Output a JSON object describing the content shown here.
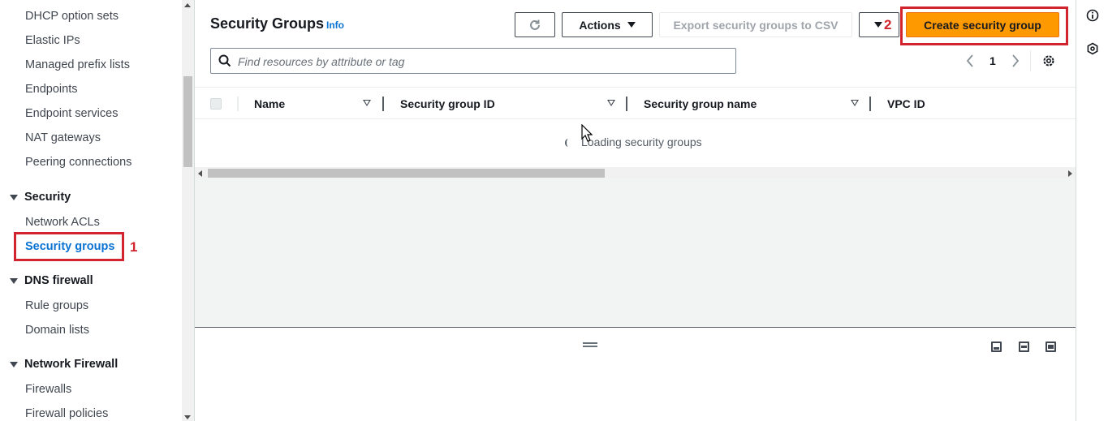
{
  "sidebar": {
    "items_top": [
      {
        "label": "DHCP option sets"
      },
      {
        "label": "Elastic IPs"
      },
      {
        "label": "Managed prefix lists"
      },
      {
        "label": "Endpoints"
      },
      {
        "label": "Endpoint services"
      },
      {
        "label": "NAT gateways"
      },
      {
        "label": "Peering connections"
      }
    ],
    "security": {
      "label": "Security",
      "items": [
        {
          "label": "Network ACLs"
        },
        {
          "label": "Security groups",
          "active": true
        }
      ]
    },
    "dns_firewall": {
      "label": "DNS firewall",
      "items": [
        {
          "label": "Rule groups"
        },
        {
          "label": "Domain lists"
        }
      ]
    },
    "network_firewall": {
      "label": "Network Firewall",
      "items": [
        {
          "label": "Firewalls"
        },
        {
          "label": "Firewall policies"
        }
      ]
    }
  },
  "annotations": {
    "step1": "1",
    "step2": "2",
    "color": "#d1242f"
  },
  "header": {
    "title": "Security Groups",
    "info": "Info",
    "refresh_icon": "refresh-icon",
    "actions_label": "Actions",
    "export_label": "Export security groups to CSV",
    "create_label": "Create security group",
    "primary_color": "#ff9900"
  },
  "search": {
    "placeholder": "Find resources by attribute or tag"
  },
  "pagination": {
    "current_page": "1"
  },
  "table": {
    "columns": [
      "Name",
      "Security group ID",
      "Security group name",
      "VPC ID"
    ],
    "loading_text": "Loading security groups"
  }
}
